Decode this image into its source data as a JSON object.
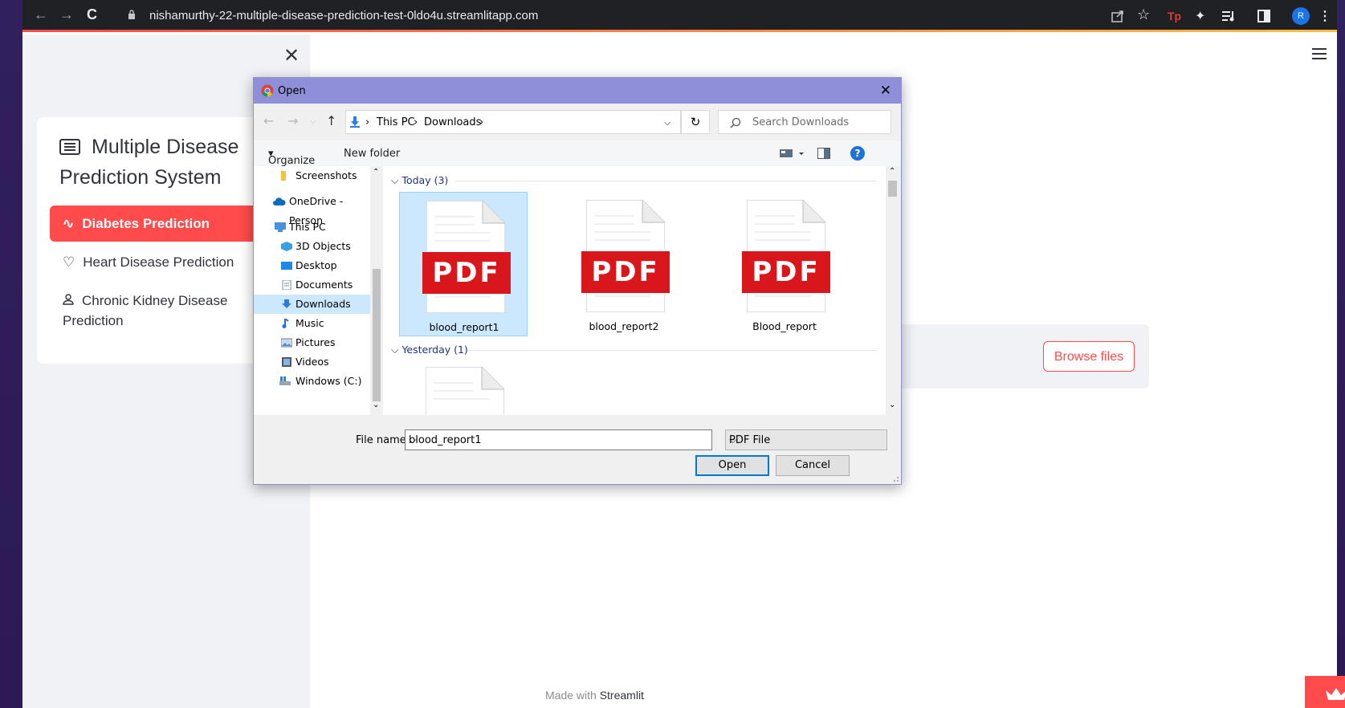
{
  "browser": {
    "url": "nishamurthy-22-multiple-disease-prediction-test-0ldo4u.streamlitapp.com",
    "avatar_letter": "R",
    "ext_tp_label": "Tp"
  },
  "sidebar": {
    "title": "Multiple Disease Prediction System",
    "items": [
      {
        "label": "Diabetes Prediction",
        "icon": "activity-icon",
        "active": true
      },
      {
        "label": "Heart Disease Prediction",
        "icon": "heart-icon",
        "active": false
      },
      {
        "label": "Chronic Kidney Disease Prediction",
        "icon": "person-icon",
        "active": false
      }
    ]
  },
  "main": {
    "browse_label": "Browse files",
    "footer_prefix": "Made with",
    "footer_brand": "Streamlit"
  },
  "dialog": {
    "title": "Open",
    "path": [
      "This PC",
      "Downloads"
    ],
    "search_placeholder": "Search Downloads",
    "organize_label": "Organize",
    "new_folder_label": "New folder",
    "tree": [
      {
        "label": "Screenshots",
        "icon": "folder-icon"
      },
      {
        "label": "OneDrive - Person",
        "icon": "cloud-icon"
      },
      {
        "label": "This PC",
        "icon": "computer-icon"
      },
      {
        "label": "3D Objects",
        "icon": "cube-icon"
      },
      {
        "label": "Desktop",
        "icon": "desktop-icon"
      },
      {
        "label": "Documents",
        "icon": "document-icon"
      },
      {
        "label": "Downloads",
        "icon": "download-icon",
        "selected": true
      },
      {
        "label": "Music",
        "icon": "music-icon"
      },
      {
        "label": "Pictures",
        "icon": "pictures-icon"
      },
      {
        "label": "Videos",
        "icon": "video-icon"
      },
      {
        "label": "Windows (C:)",
        "icon": "drive-icon"
      }
    ],
    "groups": [
      {
        "label": "Today (3)",
        "files": [
          "blood_report1",
          "blood_report2",
          "Blood_report"
        ]
      },
      {
        "label": "Yesterday (1)",
        "files": [
          ""
        ]
      }
    ],
    "pdf_badge": "PDF",
    "file_name_label": "File name:",
    "file_name_value": "blood_report1",
    "file_type_value": "PDF File",
    "open_label": "Open",
    "cancel_label": "Cancel",
    "help_glyph": "?"
  }
}
